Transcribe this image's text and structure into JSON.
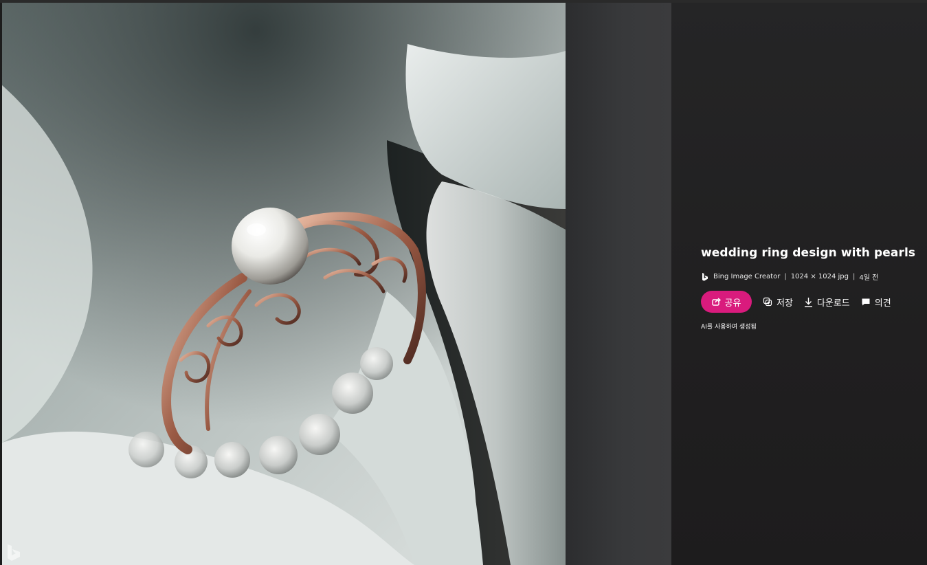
{
  "image": {
    "alt": "wedding ring design with pearls",
    "watermark_icon": "bing-logo-icon"
  },
  "details": {
    "title": "wedding ring design with pearls",
    "meta": {
      "source_icon": "bing-icon",
      "source": "Bing Image Creator",
      "separator": "|",
      "dimensions": "1024 × 1024 jpg",
      "age": "4일 전"
    },
    "actions": {
      "share": {
        "label": "공유",
        "icon": "share-icon"
      },
      "save": {
        "label": "저장",
        "icon": "save-icon"
      },
      "download": {
        "label": "다운로드",
        "icon": "download-icon"
      },
      "feedback": {
        "label": "의견",
        "icon": "comment-icon"
      }
    },
    "ai_note": "AI를 사용하여 생성됨"
  },
  "colors": {
    "accent": "#d91b7d",
    "panel_bg": "#222122",
    "text": "#ffffff"
  }
}
